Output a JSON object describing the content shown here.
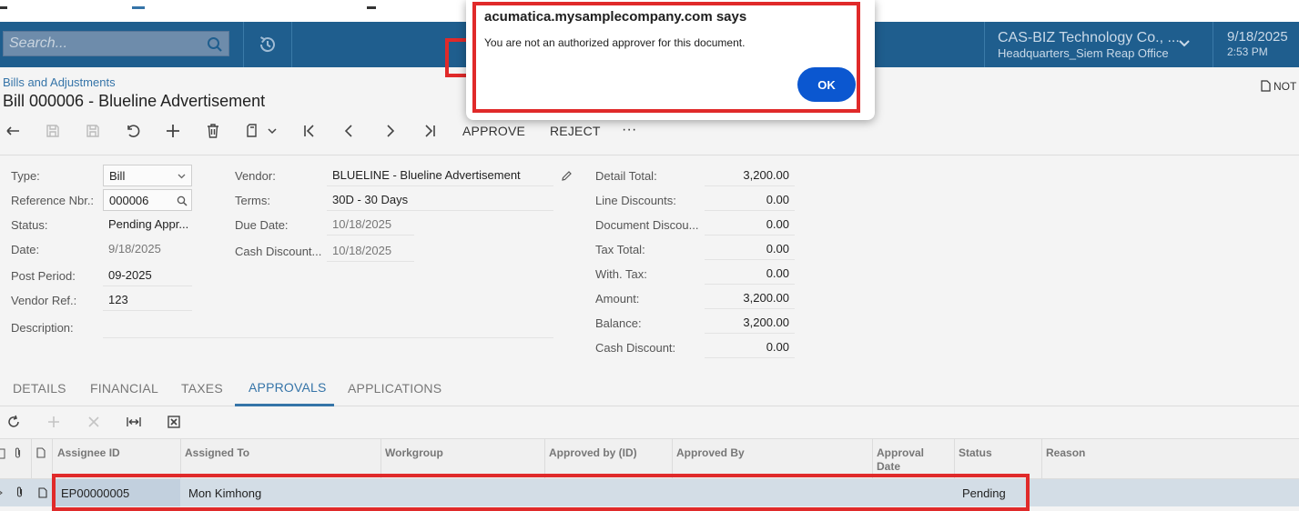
{
  "header": {
    "search_placeholder": "Search...",
    "company_name": "CAS-BIZ Technology Co., ...",
    "branch": "Headquarters_Siem Reap Office",
    "date": "9/18/2025",
    "time": "2:53 PM"
  },
  "page": {
    "breadcrumb": "Bills and Adjustments",
    "title": "Bill 000006 - Blueline Advertisement",
    "notes_label": "NOT"
  },
  "toolbar": {
    "approve_label": "APPROVE",
    "reject_label": "REJECT",
    "more_label": "···"
  },
  "form": {
    "left": [
      {
        "label": "Type:",
        "value": "Bill"
      },
      {
        "label": "Reference Nbr.:",
        "value": "000006"
      },
      {
        "label": "Status:",
        "value": "Pending Appr..."
      },
      {
        "label": "Date:",
        "value": "9/18/2025"
      },
      {
        "label": "Post Period:",
        "value": "09-2025"
      },
      {
        "label": "Vendor Ref.:",
        "value": "123"
      },
      {
        "label": "Description:",
        "value": ""
      }
    ],
    "middle": [
      {
        "label": "Vendor:",
        "value": "BLUELINE - Blueline Advertisement"
      },
      {
        "label": "Terms:",
        "value": "30D - 30 Days"
      },
      {
        "label": "Due Date:",
        "value": "10/18/2025"
      },
      {
        "label": "Cash Discount...",
        "value": "10/18/2025"
      }
    ],
    "right": [
      {
        "label": "Detail Total:",
        "value": "3,200.00"
      },
      {
        "label": "Line Discounts:",
        "value": "0.00"
      },
      {
        "label": "Document Discou...",
        "value": "0.00"
      },
      {
        "label": "Tax Total:",
        "value": "0.00"
      },
      {
        "label": "With. Tax:",
        "value": "0.00"
      },
      {
        "label": "Amount:",
        "value": "3,200.00"
      },
      {
        "label": "Balance:",
        "value": "3,200.00"
      },
      {
        "label": "Cash Discount:",
        "value": "0.00"
      }
    ]
  },
  "tabs": [
    "DETAILS",
    "FINANCIAL",
    "TAXES",
    "APPROVALS",
    "APPLICATIONS"
  ],
  "grid": {
    "columns": [
      "Assignee ID",
      "Assigned To",
      "Workgroup",
      "Approved by (ID)",
      "Approved By",
      "Approval Date",
      "Status",
      "Reason"
    ],
    "rows": [
      {
        "assignee_id": "EP00000005",
        "assigned_to": "Mon Kimhong",
        "workgroup": "",
        "approved_by_id": "",
        "approved_by": "",
        "approval_date": "",
        "status": "Pending",
        "reason": ""
      }
    ]
  },
  "dialog": {
    "title": "acumatica.mysamplecompany.com says",
    "message": "You are not an authorized approver for this document.",
    "ok_label": "OK"
  },
  "colors": {
    "header_bg": "#1f5e8e",
    "link": "#3574a8",
    "highlight": "#e02a2a",
    "ok_button": "#0b57d0"
  }
}
